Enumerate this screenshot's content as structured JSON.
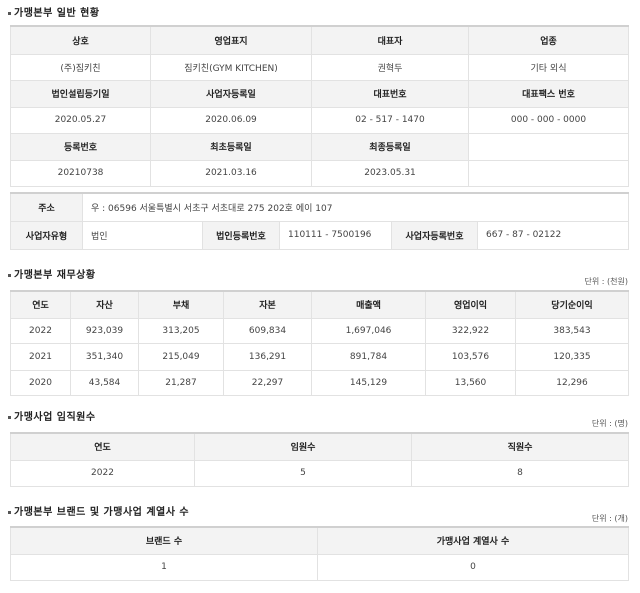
{
  "general": {
    "title": "가맹본부 일반 현황",
    "headers1": [
      "상호",
      "영업표지",
      "대표자",
      "업종"
    ],
    "values1": [
      "(주)짐키친",
      "짐키친(GYM KITCHEN)",
      "권혁두",
      "기타 외식"
    ],
    "headers2": [
      "법인설립등기일",
      "사업자등록일",
      "대표번호",
      "대표팩스 번호"
    ],
    "values2": [
      "2020.05.27",
      "2020.06.09",
      "02 - 517 - 1470",
      "000 - 000 - 0000"
    ],
    "headers3": [
      "등록번호",
      "최초등록일",
      "최종등록일"
    ],
    "values3": [
      "20210738",
      "2021.03.16",
      "2023.05.31"
    ],
    "address_label": "주소",
    "address_value": "우 : 06596 서울특별시 서초구 서초대로 275 202호 에이 107",
    "biztype_label": "사업자유형",
    "biztype_value": "법인",
    "corpnum_label": "법인등록번호",
    "corpnum_value": "110111 - 7500196",
    "biznum_label": "사업자등록번호",
    "biznum_value": "667 - 87 - 02122"
  },
  "finance": {
    "title": "가맹본부 재무상황",
    "unit": "단위 : (천원)",
    "headers": [
      "연도",
      "자산",
      "부채",
      "자본",
      "매출액",
      "영업이익",
      "당기순이익"
    ],
    "rows": [
      [
        "2022",
        "923,039",
        "313,205",
        "609,834",
        "1,697,046",
        "322,922",
        "383,543"
      ],
      [
        "2021",
        "351,340",
        "215,049",
        "136,291",
        "891,784",
        "103,576",
        "120,335"
      ],
      [
        "2020",
        "43,584",
        "21,287",
        "22,297",
        "145,129",
        "13,560",
        "12,296"
      ]
    ]
  },
  "staff": {
    "title": "가맹사업 임직원수",
    "unit": "단위 : (명)",
    "headers": [
      "연도",
      "임원수",
      "직원수"
    ],
    "row": [
      "2022",
      "5",
      "8"
    ]
  },
  "brands": {
    "title": "가맹본부 브랜드 및 가맹사업 계열사 수",
    "unit": "단위 : (개)",
    "headers": [
      "브랜드 수",
      "가맹사업 계열사 수"
    ],
    "row": [
      "1",
      "0"
    ]
  }
}
